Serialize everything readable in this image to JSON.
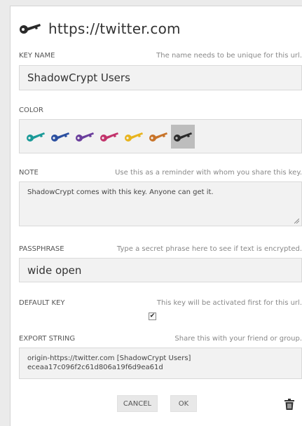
{
  "header": {
    "title": "https://twitter.com",
    "icon": "key-icon"
  },
  "key_name": {
    "label": "KEY NAME",
    "hint": "The name needs to be unique for this url.",
    "value": "ShadowCrypt Users"
  },
  "color": {
    "label": "COLOR",
    "options": [
      {
        "name": "teal",
        "hex": "#1a9a98"
      },
      {
        "name": "blue",
        "hex": "#2b4fa0"
      },
      {
        "name": "purple",
        "hex": "#6a3e9c"
      },
      {
        "name": "pink",
        "hex": "#c2336b"
      },
      {
        "name": "yellow",
        "hex": "#e8b41e"
      },
      {
        "name": "orange",
        "hex": "#c8742a"
      },
      {
        "name": "black",
        "hex": "#2a2a2a"
      }
    ],
    "selected": "black"
  },
  "note": {
    "label": "NOTE",
    "hint": "Use this as a reminder with whom you share this key.",
    "value": "ShadowCrypt comes with this key. Anyone can get it."
  },
  "passphrase": {
    "label": "PASSPHRASE",
    "hint": "Type a secret phrase here to see if text is encrypted.",
    "value": "wide open"
  },
  "default_key": {
    "label": "DEFAULT KEY",
    "hint": "This key will be activated first for this url.",
    "checked": true,
    "check_mark": "✔"
  },
  "export": {
    "label": "EXPORT STRING",
    "hint": "Share this with your friend or group.",
    "line1": "origin-https://twitter.com [ShadowCrypt Users]",
    "line2": "eceaa17c096f2c61d806a19f6d9ea61d"
  },
  "buttons": {
    "cancel": "CANCEL",
    "ok": "OK"
  },
  "icons": {
    "delete": "trash-icon"
  }
}
